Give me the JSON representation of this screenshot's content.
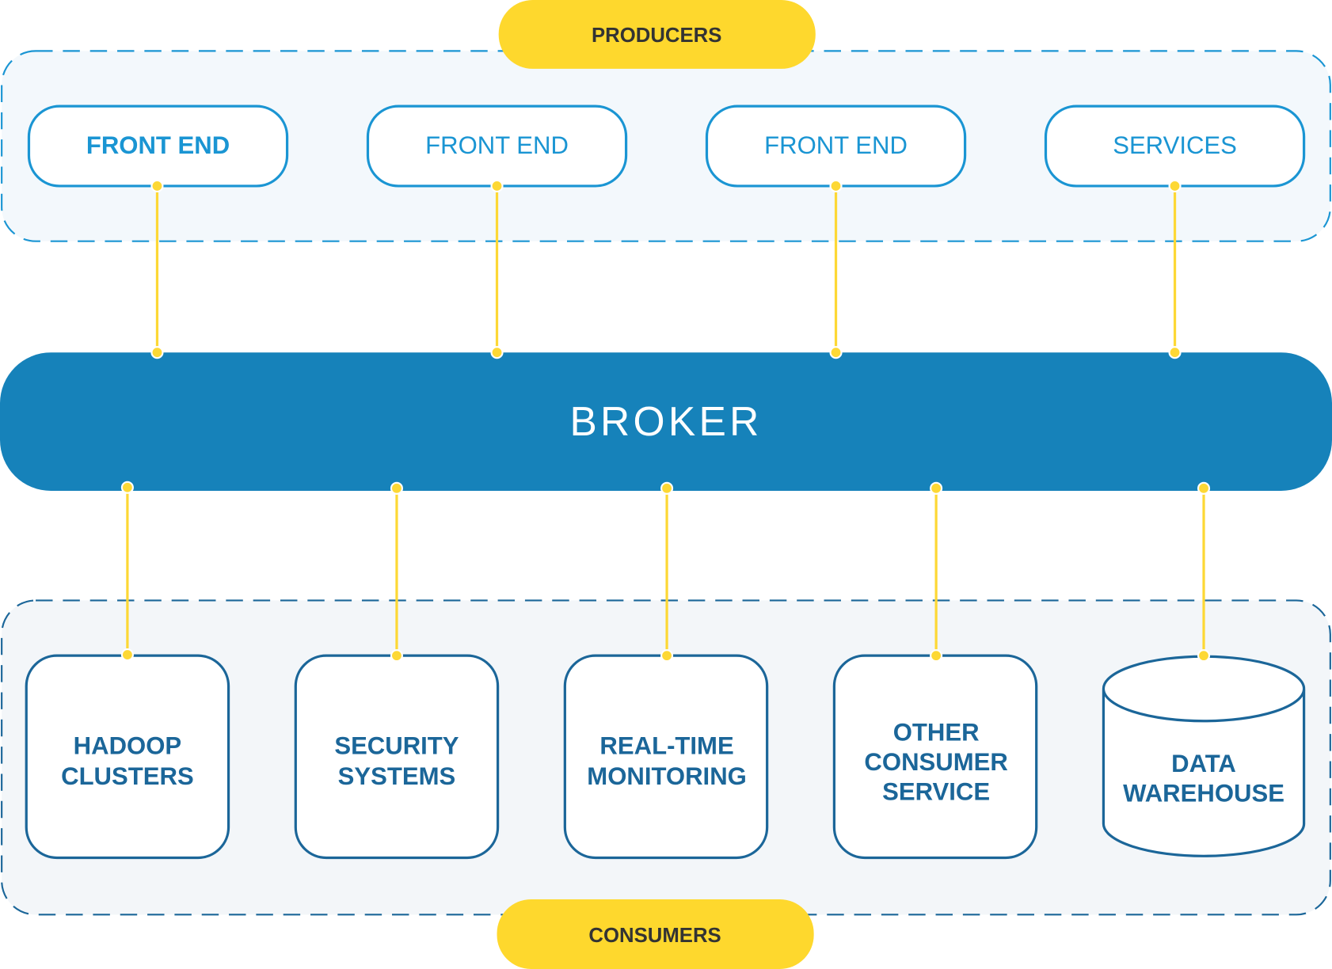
{
  "producers": {
    "label": "PRODUCERS",
    "items": [
      {
        "label": "FRONT END"
      },
      {
        "label": "FRONT END"
      },
      {
        "label": "FRONT END"
      },
      {
        "label": "SERVICES"
      }
    ]
  },
  "broker": {
    "label": "BROKER"
  },
  "consumers": {
    "label": "CONSUMERS",
    "items": [
      {
        "lines": [
          "HADOOP",
          "CLUSTERS"
        ]
      },
      {
        "lines": [
          "SECURITY",
          "SYSTEMS"
        ]
      },
      {
        "lines": [
          "REAL-TIME",
          "MONITORING"
        ]
      },
      {
        "lines": [
          "OTHER",
          "CONSUMER",
          "SERVICE"
        ]
      },
      {
        "lines": [
          "DATA",
          "WAREHOUSE"
        ],
        "shape": "database-cylinder"
      }
    ]
  },
  "colors": {
    "producer_blue": "#1a95d3",
    "consumer_blue": "#1b6699",
    "broker_blue": "#1682ba",
    "accent_yellow": "#fdd835",
    "group_background": "#f3f8fc"
  }
}
